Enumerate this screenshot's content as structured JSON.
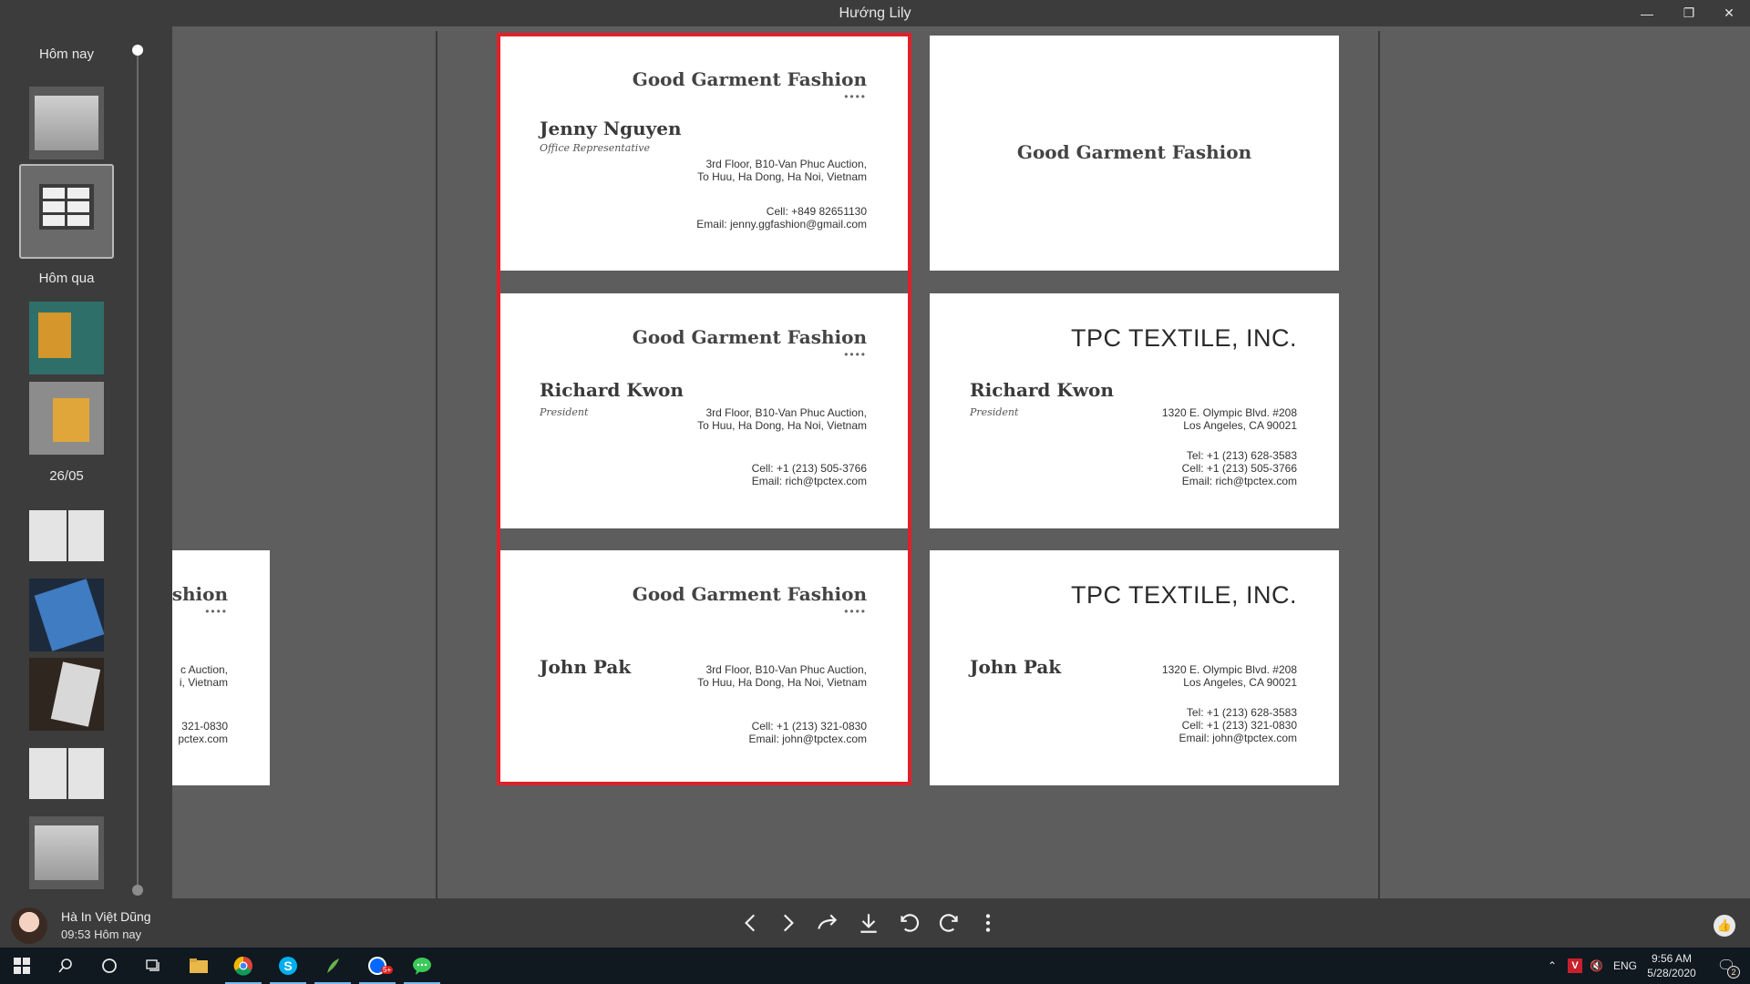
{
  "window": {
    "title": "Hướng Lily",
    "controls": {
      "minimize": "—",
      "maximize": "❐",
      "close": "✕"
    }
  },
  "sidebar": {
    "groups": [
      {
        "label": "Hôm nay"
      },
      {
        "label": "Hôm qua"
      },
      {
        "label": "26/05"
      }
    ]
  },
  "cards": [
    {
      "company": "Good Garment Fashion",
      "dots": "••••",
      "name": "Jenny Nguyen",
      "role": "Office Representative",
      "address": [
        "3rd Floor, B10-Van Phuc Auction,",
        "To Huu, Ha Dong, Ha Noi, Vietnam"
      ],
      "contact": [
        "Cell: +849 82651130",
        "Email: jenny.ggfashion@gmail.com"
      ]
    },
    {
      "company": "Good Garment Fashion"
    },
    {
      "company": "Good Garment Fashion",
      "dots": "••••",
      "name": "Richard Kwon",
      "role": "President",
      "address": [
        "3rd Floor, B10-Van Phuc Auction,",
        "To Huu, Ha Dong, Ha Noi, Vietnam"
      ],
      "contact": [
        "Cell: +1 (213) 505-3766",
        "Email: rich@tpctex.com"
      ]
    },
    {
      "company": "TPC TEXTILE, INC.",
      "name": "Richard Kwon",
      "role": "President",
      "address": [
        "1320 E. Olympic Blvd. #208",
        "Los Angeles, CA 90021"
      ],
      "contact": [
        "Tel: +1 (213) 628-3583",
        "Cell: +1 (213) 505-3766",
        "Email: rich@tpctex.com"
      ]
    },
    {
      "company": "Good Garment Fashion",
      "dots": "••••",
      "name": "John Pak",
      "address": [
        "3rd Floor, B10-Van Phuc Auction,",
        "To Huu, Ha Dong, Ha Noi, Vietnam"
      ],
      "contact": [
        "Cell: +1 (213) 321-0830",
        "Email: john@tpctex.com"
      ]
    },
    {
      "company": "TPC TEXTILE, INC.",
      "name": "John Pak",
      "address": [
        "1320 E. Olympic Blvd. #208",
        "Los Angeles, CA 90021"
      ],
      "contact": [
        "Tel: +1 (213) 628-3583",
        "Cell: +1 (213) 321-0830",
        "Email: john@tpctex.com"
      ]
    }
  ],
  "prev_image_fragment": {
    "company": "shion",
    "dots": "••••",
    "address": [
      "c Auction,",
      "i, Vietnam"
    ],
    "contact": [
      "321-0830",
      "pctex.com"
    ]
  },
  "bottom_bar": {
    "sender": "Hà In Việt Dũng",
    "sent_time": "09:53 Hôm nay",
    "tools": [
      "chevron-left",
      "chevron-right",
      "forward",
      "download",
      "rotate-left",
      "rotate-right",
      "more"
    ]
  },
  "taskbar": {
    "tray": {
      "language": "ENG"
    },
    "clock": {
      "time": "9:56 AM",
      "date": "5/28/2020"
    },
    "notifications_count": "2",
    "zalo_badge": "5+"
  },
  "colors": {
    "highlight": "#e0202a",
    "window_bg": "#3c3c3c",
    "viewer_bg": "#5e5e5e",
    "taskbar_bg": "#101820"
  }
}
